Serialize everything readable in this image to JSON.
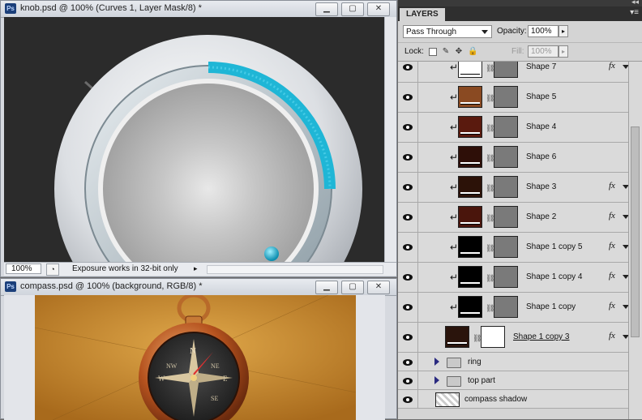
{
  "window_knob": {
    "title": "knob.psd @ 100% (Curves 1, Layer Mask/8) *",
    "zoom": "100%",
    "status": "Exposure works in 32-bit only",
    "btn_min": "▁",
    "btn_max": "▢",
    "btn_close": "✕"
  },
  "window_compass": {
    "title": "compass.psd @ 100% (background, RGB/8) *",
    "btn_min": "▁",
    "btn_max": "▢",
    "btn_close": "✕"
  },
  "app": {
    "ps_badge": "Ps"
  },
  "panel": {
    "tab": "LAYERS",
    "collapse": "◂◂",
    "menu": "▾≡",
    "blend_mode": "Pass Through",
    "opacity_label": "Opacity:",
    "opacity_value": "100%",
    "lock_label": "Lock:",
    "fill_label": "Fill:",
    "fill_value": "100%",
    "arrow": "▸"
  },
  "layers": [
    {
      "name": "Shape 7",
      "thumb": "#ffffff",
      "fx": "fx",
      "link": false
    },
    {
      "name": "Shape 5",
      "thumb": "#8a4a22",
      "fx": "",
      "link": false
    },
    {
      "name": "Shape 4",
      "thumb": "#5a1a0e",
      "fx": "",
      "link": false
    },
    {
      "name": "Shape 6",
      "thumb": "#2e0f08",
      "fx": "",
      "link": false
    },
    {
      "name": "Shape 3",
      "thumb": "#2c1208",
      "fx": "fx",
      "link": false
    },
    {
      "name": "Shape 2",
      "thumb": "#4a150c",
      "fx": "fx",
      "link": false
    },
    {
      "name": "Shape 1 copy 5",
      "thumb": "#000000",
      "fx": "fx",
      "link": false
    },
    {
      "name": "Shape 1 copy 4",
      "thumb": "#000000",
      "fx": "fx",
      "link": false
    },
    {
      "name": "Shape 1 copy",
      "thumb": "#000000",
      "fx": "fx",
      "link": false
    },
    {
      "name": "Shape 1 copy 3",
      "thumb": "#2a140c",
      "fx": "fx",
      "link": true
    }
  ],
  "groups": [
    {
      "name": "ring"
    },
    {
      "name": "top part"
    }
  ],
  "bottom_layer": {
    "name": "compass shadow"
  },
  "colors": {
    "accent": "#1fb6d6",
    "canvas_dark": "#2b2b2b",
    "parchment": "#c98a2c"
  }
}
